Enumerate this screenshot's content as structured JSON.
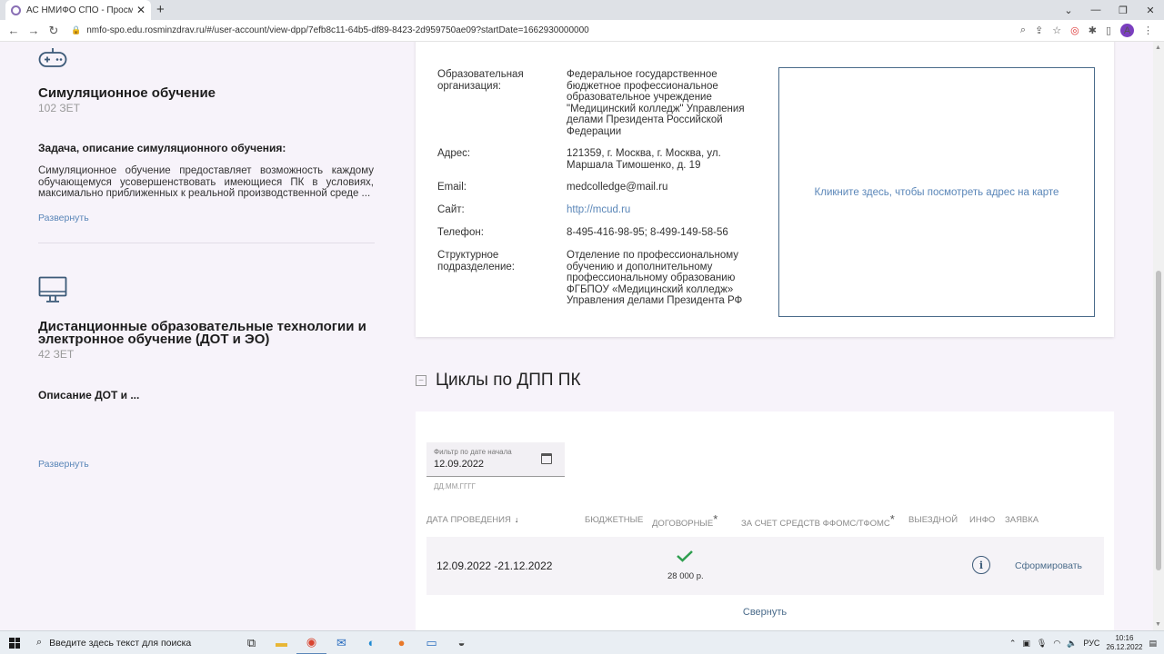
{
  "browser": {
    "tab_title": "АС НМИФО СПО - Просмотр Д",
    "url": "nmfo-spo.edu.rosminzdrav.ru/#/user-account/view-dpp/7efb8c11-64b5-df89-8423-2d959750ae09?startDate=1662930000000",
    "avatar_letter": "A"
  },
  "left": {
    "sim": {
      "title": "Симуляционное обучение",
      "zet": "102 ЗЕТ",
      "subtitle": "Задача, описание симуляционного обучения:",
      "description": "Симуляционное обучение предоставляет возможность каждому обучающемуся усовершенствовать имеющиеся ПК в условиях, максимально приближенных к реальной производственной среде ...",
      "expand": "Развернуть"
    },
    "dot": {
      "title": "Дистанционные образовательные технологии и электронное обучение (ДОТ и ЭО)",
      "zet": "42 ЗЕТ",
      "subtitle": "Описание ДОТ и ...",
      "expand": "Развернуть"
    }
  },
  "org": {
    "rows": [
      {
        "label": "Образовательная организация:",
        "value": "Федеральное государственное бюджетное профессиональное образовательное учреждение \"Медицинский колледж\" Управления делами Президента Российской Федерации"
      },
      {
        "label": "Адрес:",
        "value": "121359, г. Москва, г. Москва, ул. Маршала Тимошенко, д. 19"
      },
      {
        "label": "Email:",
        "value": "medcolledge@mail.ru"
      },
      {
        "label": "Сайт:",
        "value": "http://mcud.ru"
      },
      {
        "label": "Телефон:",
        "value": "8-495-416-98-95; 8-499-149-58-56"
      },
      {
        "label": "Структурное подразделение:",
        "value": "Отделение по профессиональному обучению и дополнительному профессиональному образованию ФГБПОУ «Медицинский колледж» Управления делами Президента РФ"
      }
    ],
    "map_text": "Кликните здесь, чтобы посмотреть адрес на карте"
  },
  "cycles": {
    "title": "Циклы по ДПП ПК",
    "filter_label": "Фильтр по дате начала",
    "filter_value": "12.09.2022",
    "filter_hint": "ДД.ММ.ГГГГ",
    "headers": {
      "date": "ДАТА ПРОВЕДЕНИЯ",
      "budget": "БЮДЖЕТНЫЕ",
      "contract": "ДОГОВОРНЫЕ",
      "foms": "ЗА СЧЕТ СРЕДСТВ ФФОМС/ТФОМС",
      "outgoing": "ВЫЕЗДНОЙ",
      "info": "ИНФО",
      "request": "ЗАЯВКА"
    },
    "row": {
      "date": "12.09.2022 -21.12.2022",
      "price": "28 000 р.",
      "action": "Сформировать"
    },
    "collapse": "Свернуть"
  },
  "taskbar": {
    "search_placeholder": "Введите здесь текст для поиска",
    "lang": "РУС",
    "time": "10:16",
    "date": "26.12.2022"
  },
  "colors": {
    "link": "#5a86b8",
    "check": "#2e9e4f",
    "page_bg": "#f7f3fa"
  }
}
